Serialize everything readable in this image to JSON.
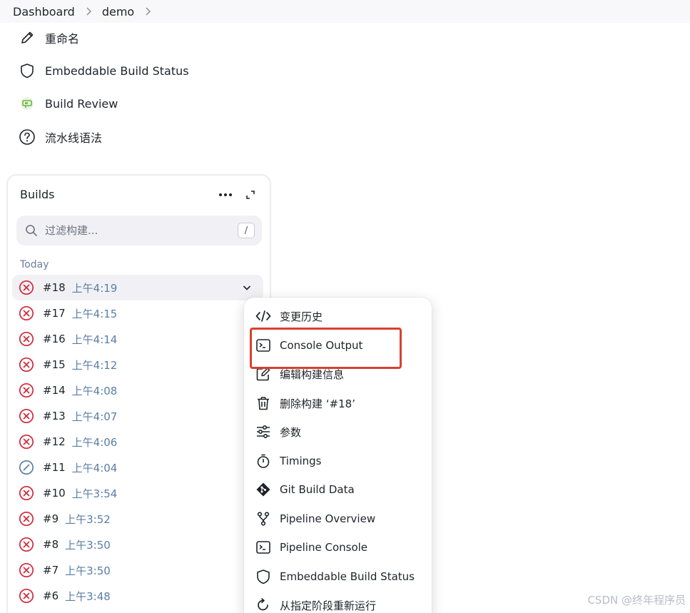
{
  "breadcrumb": {
    "items": [
      "Dashboard",
      "demo"
    ]
  },
  "side_menu": {
    "items": [
      {
        "label": "重命名",
        "icon": "pencil-icon"
      },
      {
        "label": "Embeddable Build Status",
        "icon": "shield-icon"
      },
      {
        "label": "Build Review",
        "icon": "review-badge-icon"
      },
      {
        "label": "流水线语法",
        "icon": "help-circle-icon"
      }
    ]
  },
  "builds": {
    "title": "Builds",
    "search_placeholder": "过滤构建...",
    "search_shortcut": "/",
    "group_label": "Today",
    "rows": [
      {
        "number": "#18",
        "time": "上午4:19",
        "status": "failed"
      },
      {
        "number": "#17",
        "time": "上午4:15",
        "status": "failed"
      },
      {
        "number": "#16",
        "time": "上午4:14",
        "status": "failed"
      },
      {
        "number": "#15",
        "time": "上午4:12",
        "status": "failed"
      },
      {
        "number": "#14",
        "time": "上午4:08",
        "status": "failed"
      },
      {
        "number": "#13",
        "time": "上午4:07",
        "status": "failed"
      },
      {
        "number": "#12",
        "time": "上午4:06",
        "status": "failed"
      },
      {
        "number": "#11",
        "time": "上午4:04",
        "status": "aborted"
      },
      {
        "number": "#10",
        "time": "上午3:54",
        "status": "failed"
      },
      {
        "number": "#9",
        "time": "上午3:52",
        "status": "failed"
      },
      {
        "number": "#8",
        "time": "上午3:50",
        "status": "failed"
      },
      {
        "number": "#7",
        "time": "上午3:50",
        "status": "failed"
      },
      {
        "number": "#6",
        "time": "上午3:48",
        "status": "failed"
      }
    ]
  },
  "dropdown": {
    "items": [
      {
        "label": "变更历史",
        "icon": "code-icon"
      },
      {
        "label": "Console Output",
        "icon": "terminal-icon"
      },
      {
        "label": "编辑构建信息",
        "icon": "edit-icon"
      },
      {
        "label": "删除构建 ‘#18’",
        "icon": "trash-icon"
      },
      {
        "label": "参数",
        "icon": "sliders-icon"
      },
      {
        "label": "Timings",
        "icon": "stopwatch-icon"
      },
      {
        "label": "Git Build Data",
        "icon": "git-icon"
      },
      {
        "label": "Pipeline Overview",
        "icon": "branch-icon"
      },
      {
        "label": "Pipeline Console",
        "icon": "terminal-icon"
      },
      {
        "label": "Embeddable Build Status",
        "icon": "shield-icon"
      },
      {
        "label": "从指定阶段重新运行",
        "icon": "rerun-icon"
      }
    ]
  },
  "colors": {
    "failed": "#d2283a",
    "aborted": "#5a7ea6",
    "highlight": "#d8402f",
    "time_link": "#5a7ea6"
  },
  "watermark": "CSDN @终年程序员"
}
